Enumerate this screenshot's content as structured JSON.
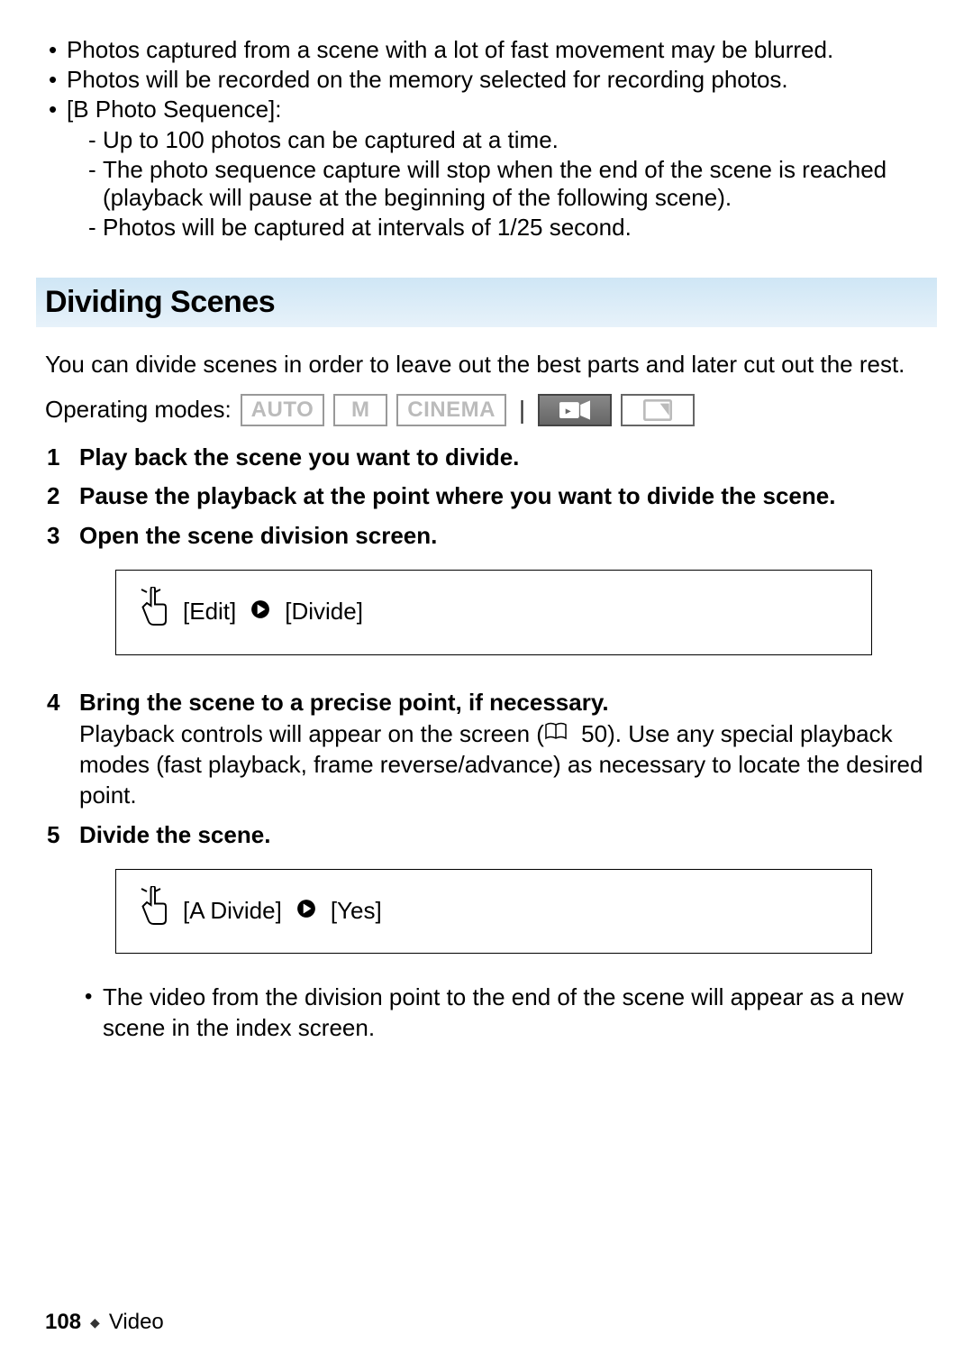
{
  "top_bullets": {
    "b1": "Photos captured from a scene with a lot of fast movement may be blurred.",
    "b2": "Photos will be recorded on the memory selected for recording photos.",
    "b3_label": "[B   Photo Sequence]:",
    "b3_sub1": "Up to 100 photos can be captured at a time.",
    "b3_sub2": "The photo sequence capture will stop when the end of the scene is reached (playback will pause at the beginning of the following scene).",
    "b3_sub3": "Photos will be captured at intervals of 1/25 second."
  },
  "section_heading": "Dividing Scenes",
  "intro": "You can divide scenes in order to leave out the best parts and later cut out the rest.",
  "operating_modes": {
    "label": "Operating modes:",
    "modes": {
      "auto": "AUTO",
      "m": "M",
      "cinema": "CINEMA"
    }
  },
  "steps": {
    "s1": "Play back the scene you want to divide.",
    "s2": "Pause the playback at the point where you want to divide the scene.",
    "s3": "Open the scene division screen.",
    "s3_touch_a": "[Edit]",
    "s3_touch_b": "[Divide]",
    "s4_title": "Bring the scene to a precise point, if necessary.",
    "s4_body_a": "Playback controls will appear on the screen (",
    "s4_ref": "50",
    "s4_body_b": "). Use any special playback modes (fast playback, frame reverse/advance) as necessary to locate the desired point.",
    "s5": "Divide the scene.",
    "s5_touch_a": "[A   Divide]",
    "s5_touch_b": "[Yes]",
    "s5_bullet": "The video from the division point to the end of the scene will appear as a new scene in the index screen."
  },
  "footer": {
    "page": "108",
    "section": "Video"
  }
}
